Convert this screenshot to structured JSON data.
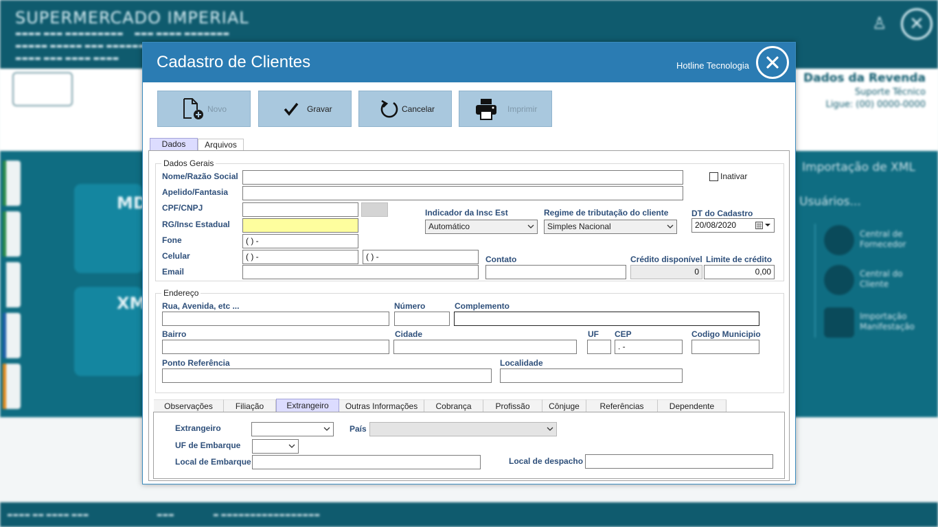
{
  "background": {
    "title": "SUPERMERCADO IMPERIAL",
    "dealer": {
      "title": "Dados da Revenda",
      "support": "Suporte Técnico",
      "phone": "Ligue: (00) 0000-0000"
    },
    "right_texts": [
      "Importação de XML",
      "Usuários..."
    ],
    "right_items": [
      {
        "label": "Central de Fornecedor"
      },
      {
        "label": "Central do Cliente"
      },
      {
        "label": "Importação Manifestação"
      }
    ],
    "tiles": [
      {
        "label": "MD"
      },
      {
        "label": "XM"
      }
    ]
  },
  "dialog": {
    "title": "Cadastro de Clientes",
    "brand": "Hotline Tecnologia",
    "toolbar": {
      "novo": "Novo",
      "gravar": "Gravar",
      "cancelar": "Cancelar",
      "imprimir": "Imprimir"
    },
    "tabs": {
      "dados": "Dados",
      "arquivos": "Arquivos"
    },
    "dados_gerais": {
      "group_label": "Dados Gerais",
      "nome_label": "Nome/Razão Social",
      "apelido_label": "Apelido/Fantasia",
      "cpf_label": "CPF/CNPJ",
      "rg_label": "RG/Insc Estadual",
      "fone_label": "Fone",
      "fone_value": "(  )     -",
      "celular_label": "Celular",
      "celular_value": "(  )     -",
      "celular2_value": "(  )     -",
      "email_label": "Email",
      "inativar_label": "Inativar",
      "indicador_label": "Indicador da Insc Est",
      "indicador_value": "Automático",
      "regime_label": "Regime de tributação do cliente",
      "regime_value": "Simples Nacional",
      "dt_cadastro_label": "DT do Cadastro",
      "dt_cadastro_value": "20/08/2020",
      "contato_label": "Contato",
      "credito_label": "Crédito disponível",
      "credito_value": "0",
      "limite_label": "Limite de crédito",
      "limite_value": "0,00"
    },
    "endereco": {
      "group_label": "Endereço",
      "rua_label": "Rua, Avenida, etc ...",
      "numero_label": "Número",
      "complemento_label": "Complemento",
      "bairro_label": "Bairro",
      "cidade_label": "Cidade",
      "uf_label": "UF",
      "cep_label": "CEP",
      "cep_value": " .   -",
      "codigo_municipio_label": "Codigo Municipio",
      "ponto_referencia_label": "Ponto Referência",
      "localidade_label": "Localidade"
    },
    "bottom_tabs": [
      "Observações",
      "Filiação",
      "Extrangeiro",
      "Outras Informações",
      "Cobrança",
      "Profissão",
      "Cônjuge",
      "Referências",
      "Dependente"
    ],
    "extrangeiro": {
      "extrangeiro_label": "Extrangeiro",
      "pais_label": "País",
      "uf_embarque_label": "UF de Embarque",
      "local_embarque_label": "Local de Embarque",
      "local_despacho_label": "Local de despacho"
    }
  }
}
